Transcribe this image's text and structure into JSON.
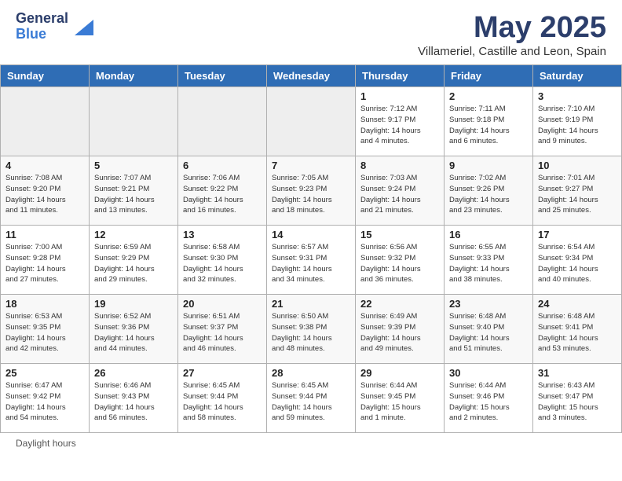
{
  "header": {
    "logo_general": "General",
    "logo_blue": "Blue",
    "main_title": "May 2025",
    "subtitle": "Villameriel, Castille and Leon, Spain"
  },
  "days_of_week": [
    "Sunday",
    "Monday",
    "Tuesday",
    "Wednesday",
    "Thursday",
    "Friday",
    "Saturday"
  ],
  "weeks": [
    [
      {
        "number": "",
        "info": "",
        "empty": true
      },
      {
        "number": "",
        "info": "",
        "empty": true
      },
      {
        "number": "",
        "info": "",
        "empty": true
      },
      {
        "number": "",
        "info": "",
        "empty": true
      },
      {
        "number": "1",
        "info": "Sunrise: 7:12 AM\nSunset: 9:17 PM\nDaylight: 14 hours\nand 4 minutes.",
        "empty": false
      },
      {
        "number": "2",
        "info": "Sunrise: 7:11 AM\nSunset: 9:18 PM\nDaylight: 14 hours\nand 6 minutes.",
        "empty": false
      },
      {
        "number": "3",
        "info": "Sunrise: 7:10 AM\nSunset: 9:19 PM\nDaylight: 14 hours\nand 9 minutes.",
        "empty": false
      }
    ],
    [
      {
        "number": "4",
        "info": "Sunrise: 7:08 AM\nSunset: 9:20 PM\nDaylight: 14 hours\nand 11 minutes.",
        "empty": false
      },
      {
        "number": "5",
        "info": "Sunrise: 7:07 AM\nSunset: 9:21 PM\nDaylight: 14 hours\nand 13 minutes.",
        "empty": false
      },
      {
        "number": "6",
        "info": "Sunrise: 7:06 AM\nSunset: 9:22 PM\nDaylight: 14 hours\nand 16 minutes.",
        "empty": false
      },
      {
        "number": "7",
        "info": "Sunrise: 7:05 AM\nSunset: 9:23 PM\nDaylight: 14 hours\nand 18 minutes.",
        "empty": false
      },
      {
        "number": "8",
        "info": "Sunrise: 7:03 AM\nSunset: 9:24 PM\nDaylight: 14 hours\nand 21 minutes.",
        "empty": false
      },
      {
        "number": "9",
        "info": "Sunrise: 7:02 AM\nSunset: 9:26 PM\nDaylight: 14 hours\nand 23 minutes.",
        "empty": false
      },
      {
        "number": "10",
        "info": "Sunrise: 7:01 AM\nSunset: 9:27 PM\nDaylight: 14 hours\nand 25 minutes.",
        "empty": false
      }
    ],
    [
      {
        "number": "11",
        "info": "Sunrise: 7:00 AM\nSunset: 9:28 PM\nDaylight: 14 hours\nand 27 minutes.",
        "empty": false
      },
      {
        "number": "12",
        "info": "Sunrise: 6:59 AM\nSunset: 9:29 PM\nDaylight: 14 hours\nand 29 minutes.",
        "empty": false
      },
      {
        "number": "13",
        "info": "Sunrise: 6:58 AM\nSunset: 9:30 PM\nDaylight: 14 hours\nand 32 minutes.",
        "empty": false
      },
      {
        "number": "14",
        "info": "Sunrise: 6:57 AM\nSunset: 9:31 PM\nDaylight: 14 hours\nand 34 minutes.",
        "empty": false
      },
      {
        "number": "15",
        "info": "Sunrise: 6:56 AM\nSunset: 9:32 PM\nDaylight: 14 hours\nand 36 minutes.",
        "empty": false
      },
      {
        "number": "16",
        "info": "Sunrise: 6:55 AM\nSunset: 9:33 PM\nDaylight: 14 hours\nand 38 minutes.",
        "empty": false
      },
      {
        "number": "17",
        "info": "Sunrise: 6:54 AM\nSunset: 9:34 PM\nDaylight: 14 hours\nand 40 minutes.",
        "empty": false
      }
    ],
    [
      {
        "number": "18",
        "info": "Sunrise: 6:53 AM\nSunset: 9:35 PM\nDaylight: 14 hours\nand 42 minutes.",
        "empty": false
      },
      {
        "number": "19",
        "info": "Sunrise: 6:52 AM\nSunset: 9:36 PM\nDaylight: 14 hours\nand 44 minutes.",
        "empty": false
      },
      {
        "number": "20",
        "info": "Sunrise: 6:51 AM\nSunset: 9:37 PM\nDaylight: 14 hours\nand 46 minutes.",
        "empty": false
      },
      {
        "number": "21",
        "info": "Sunrise: 6:50 AM\nSunset: 9:38 PM\nDaylight: 14 hours\nand 48 minutes.",
        "empty": false
      },
      {
        "number": "22",
        "info": "Sunrise: 6:49 AM\nSunset: 9:39 PM\nDaylight: 14 hours\nand 49 minutes.",
        "empty": false
      },
      {
        "number": "23",
        "info": "Sunrise: 6:48 AM\nSunset: 9:40 PM\nDaylight: 14 hours\nand 51 minutes.",
        "empty": false
      },
      {
        "number": "24",
        "info": "Sunrise: 6:48 AM\nSunset: 9:41 PM\nDaylight: 14 hours\nand 53 minutes.",
        "empty": false
      }
    ],
    [
      {
        "number": "25",
        "info": "Sunrise: 6:47 AM\nSunset: 9:42 PM\nDaylight: 14 hours\nand 54 minutes.",
        "empty": false
      },
      {
        "number": "26",
        "info": "Sunrise: 6:46 AM\nSunset: 9:43 PM\nDaylight: 14 hours\nand 56 minutes.",
        "empty": false
      },
      {
        "number": "27",
        "info": "Sunrise: 6:45 AM\nSunset: 9:44 PM\nDaylight: 14 hours\nand 58 minutes.",
        "empty": false
      },
      {
        "number": "28",
        "info": "Sunrise: 6:45 AM\nSunset: 9:44 PM\nDaylight: 14 hours\nand 59 minutes.",
        "empty": false
      },
      {
        "number": "29",
        "info": "Sunrise: 6:44 AM\nSunset: 9:45 PM\nDaylight: 15 hours\nand 1 minute.",
        "empty": false
      },
      {
        "number": "30",
        "info": "Sunrise: 6:44 AM\nSunset: 9:46 PM\nDaylight: 15 hours\nand 2 minutes.",
        "empty": false
      },
      {
        "number": "31",
        "info": "Sunrise: 6:43 AM\nSunset: 9:47 PM\nDaylight: 15 hours\nand 3 minutes.",
        "empty": false
      }
    ]
  ],
  "footer": "Daylight hours"
}
